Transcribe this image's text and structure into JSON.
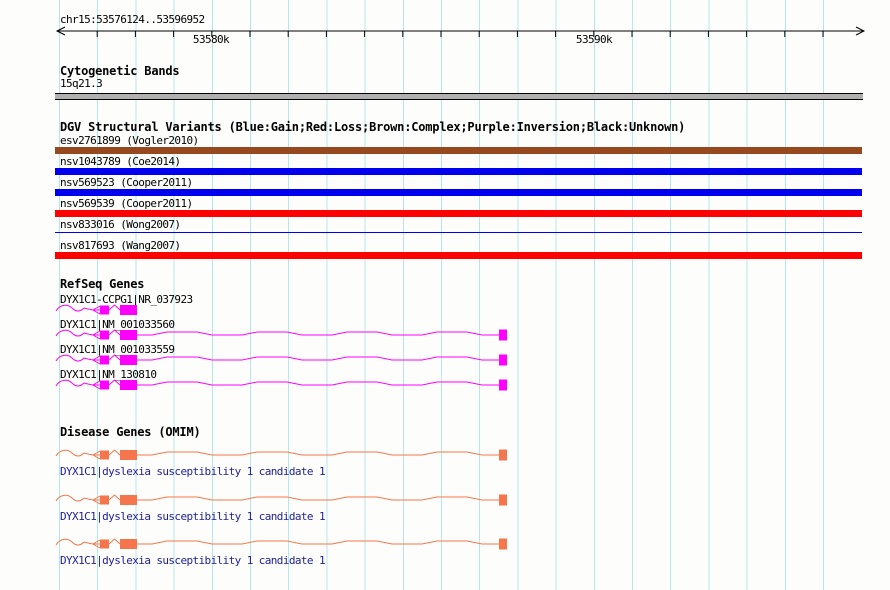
{
  "ruler": {
    "region": "chr15:53576124..53596952",
    "ticks": [
      {
        "label": "53580k"
      },
      {
        "label": "53590k"
      }
    ]
  },
  "tracks": {
    "cytobands": {
      "title": "Cytogenetic Bands",
      "band": {
        "label": "15q21.3",
        "fill": "#b0b0b0",
        "border": "#000000"
      }
    },
    "dgv": {
      "title": "DGV Structural Variants (Blue:Gain;Red:Loss;Brown:Complex;Purple:Inversion;Black:Unknown)",
      "variants": [
        {
          "label": "esv2761899 (Vogler2010)",
          "type": "complex",
          "color": "#96491e",
          "thin": false
        },
        {
          "label": "nsv1043789 (Coe2014)",
          "type": "gain",
          "color": "#0000ee",
          "thin": false
        },
        {
          "label": "nsv569523 (Cooper2011)",
          "type": "gain",
          "color": "#0000ee",
          "thin": false
        },
        {
          "label": "nsv569539 (Cooper2011)",
          "type": "loss",
          "color": "#ff0000",
          "thin": false
        },
        {
          "label": "nsv833016 (Wong2007)",
          "type": "gain",
          "color": "#0000ee",
          "thin": true
        },
        {
          "label": "nsv817693 (Wang2007)",
          "type": "loss",
          "color": "#ff0000",
          "thin": false
        }
      ]
    },
    "refseq": {
      "title": "RefSeq Genes",
      "color": "#ff00ff",
      "genes": [
        {
          "label": "DYX1C1-CCPG1|NR_037923",
          "extended": false
        },
        {
          "label": "DYX1C1|NM_001033560",
          "extended": true
        },
        {
          "label": "DYX1C1|NM_001033559",
          "extended": true
        },
        {
          "label": "DYX1C1|NM_130810",
          "extended": true
        }
      ]
    },
    "omim": {
      "title": "Disease Genes (OMIM)",
      "color": "#f5764c",
      "label_color": "#20209a",
      "genes": [
        {
          "label": "DYX1C1|dyslexia susceptibility 1 candidate 1",
          "extended": true
        },
        {
          "label": "DYX1C1|dyslexia susceptibility 1 candidate 1",
          "extended": true
        },
        {
          "label": "DYX1C1|dyslexia susceptibility 1 candidate 1",
          "extended": true
        }
      ]
    }
  },
  "colors": {
    "background": "#fdfefc",
    "grid": "#b2e8e8",
    "axis": "#000000"
  }
}
